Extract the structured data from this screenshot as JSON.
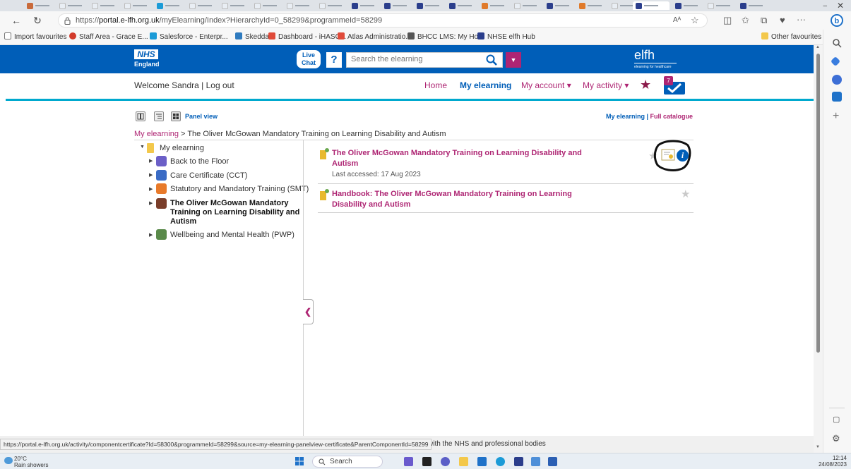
{
  "browser": {
    "url_prefix": "https://",
    "url_domain": "portal.e-lfh.org.uk",
    "url_rest": "/myElearning/Index?HierarchyId=0_58299&programmeId=58299",
    "reader_icon": "Aᴬ",
    "more_label": "···",
    "favourites": [
      {
        "label": "Import favourites",
        "color": "#8a8a8a"
      },
      {
        "label": "Staff Area - Grace E...",
        "color": "#d23b2b"
      },
      {
        "label": "Salesforce - Enterpr...",
        "color": "#1b9bd7"
      },
      {
        "label": "Skedda",
        "color": "#2f7bbf"
      },
      {
        "label": "Dashboard - iHASC...",
        "color": "#e04b3a"
      },
      {
        "label": "Atlas Administratio...",
        "color": "#e04b3a"
      },
      {
        "label": "BHCC LMS: My Ho...",
        "color": "#555555"
      },
      {
        "label": "NHSE elfh Hub",
        "color": "#2b3e8c"
      }
    ],
    "other_favourites": "Other favourites",
    "status_url": "https://portal.e-lfh.org.uk/activity/componentcertificate?Id=58300&programmeId=58299&source=my-elearning-panelview-certificate&ParentComponentId=58299"
  },
  "header": {
    "nhs_logo": "NHS",
    "nhs_sub": "England",
    "live_chat_1": "Live",
    "live_chat_2": "Chat",
    "help": "?",
    "search_placeholder": "Search the elearning",
    "elfh": "elfh",
    "elfh_sub": "elearning for healthcare"
  },
  "welcome": {
    "text": "Welcome Sandra |",
    "logout": "Log out"
  },
  "nav": {
    "home": "Home",
    "my_elearning": "My elearning",
    "my_account": "My account ▾",
    "my_activity": "My activity ▾",
    "notification_count": "7"
  },
  "view": {
    "panel_view": "Panel view",
    "my_elearning_link": "My elearning",
    "separator": " | ",
    "full_catalogue": "Full catalogue"
  },
  "breadcrumb": {
    "root": "My elearning",
    "sep": " > ",
    "current": "The Oliver McGowan Mandatory Training on Learning Disability and Autism"
  },
  "tree": {
    "root": "My elearning",
    "items": [
      {
        "label": "Back to the Floor",
        "color": "#6b5fc7",
        "bold": false
      },
      {
        "label": "Care Certificate (CCT)",
        "color": "#3a6bc5",
        "bold": false
      },
      {
        "label": "Statutory and Mandatory Training (SMT)",
        "color": "#e87a2a",
        "bold": false
      },
      {
        "label_lines": [
          "The Oliver McGowan Mandatory",
          "Training on Learning Disability and",
          "Autism"
        ],
        "color": "#7a3e2a",
        "bold": true
      },
      {
        "label": "Wellbeing and Mental Health (PWP)",
        "color": "#5a8a4a",
        "bold": false
      }
    ]
  },
  "content": {
    "items": [
      {
        "title_lines": [
          "The Oliver McGowan Mandatory Training on Learning Disability and",
          "Autism"
        ],
        "meta": "Last accessed: 17 Aug 2023"
      },
      {
        "title_lines": [
          "Handbook: The Oliver McGowan Mandatory Training on Learning",
          "Disability and Autism"
        ],
        "meta": ""
      }
    ],
    "info_glyph": "i"
  },
  "footer": {
    "text": "with the NHS and professional bodies"
  },
  "taskbar": {
    "temp": "20°C",
    "weather": "Rain showers",
    "search": "Search",
    "time": "12:14",
    "date": "24/08/2023"
  }
}
